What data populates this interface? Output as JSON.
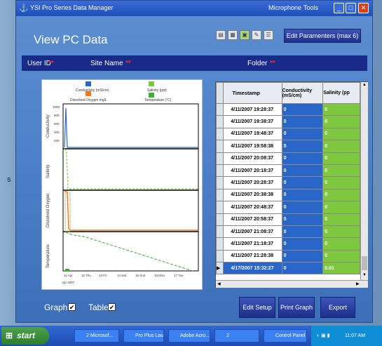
{
  "window": {
    "title": "YSI Pro Series Data Manager",
    "menu": [
      "Microphone",
      "Tools"
    ],
    "page_title": "View PC Data",
    "edit_params_label": "Edit Paramenters (max 6)"
  },
  "fields": [
    {
      "label": "User ID",
      "required": "**"
    },
    {
      "label": "Site Name",
      "required": "**"
    },
    {
      "label": "Folder",
      "required": "**"
    }
  ],
  "graph": {
    "legend": [
      "Conductivity (mS/cm)",
      "Salinity (ppt)",
      "Dissolved Oxygen mg/L",
      "Temperature (°C)"
    ],
    "axes": [
      "Conductivity",
      "Salinity",
      "Dissolved Oxygen",
      "Temperature"
    ],
    "y_ticks": {
      "conductivity": [
        "1000",
        "800",
        "600",
        "400",
        "200"
      ]
    },
    "x_ticks": [
      "11 Apr",
      "12 Thu",
      "13 Fri",
      "14 Sat",
      "15 Sun",
      "16 Mon",
      "17 Tue"
    ],
    "x_sub": "Apr 2007"
  },
  "table": {
    "columns": [
      "Timestamp",
      "Conductivity (mS/cm)",
      "Salinity (pp"
    ],
    "rows": [
      {
        "ts": "4/11/2007 19:28:37",
        "cond": "0",
        "sal": "0"
      },
      {
        "ts": "4/11/2007 19:38:37",
        "cond": "0",
        "sal": "0"
      },
      {
        "ts": "4/11/2007 19:48:37",
        "cond": "0",
        "sal": "0"
      },
      {
        "ts": "4/11/2007 19:58:38",
        "cond": "0",
        "sal": "0"
      },
      {
        "ts": "4/11/2007 20:08:37",
        "cond": "0",
        "sal": "0"
      },
      {
        "ts": "4/11/2007 20:18:37",
        "cond": "0",
        "sal": "0"
      },
      {
        "ts": "4/11/2007 20:28:37",
        "cond": "0",
        "sal": "0"
      },
      {
        "ts": "4/11/2007 20:38:38",
        "cond": "0",
        "sal": "0"
      },
      {
        "ts": "4/11/2007 20:48:37",
        "cond": "0",
        "sal": "0"
      },
      {
        "ts": "4/11/2007 20:58:37",
        "cond": "0",
        "sal": "0"
      },
      {
        "ts": "4/11/2007 21:08:37",
        "cond": "0",
        "sal": "0"
      },
      {
        "ts": "4/11/2007 21:18:37",
        "cond": "0",
        "sal": "0"
      },
      {
        "ts": "4/11/2007 21:28:38",
        "cond": "0",
        "sal": "0"
      },
      {
        "ts": "4/17/2007 15:32:27",
        "cond": "0",
        "sal": "0.01"
      }
    ]
  },
  "controls": {
    "graph_label": "Graph",
    "table_label": "Table",
    "check_mark": "✔",
    "edit_setup": "Edit Setup",
    "print_graph": "Print Graph",
    "export": "Export"
  },
  "taskbar": {
    "start": "start",
    "tasks": [
      "2 Microsof...",
      "Pro Plus Lau...",
      "Adobe Acro...",
      "2",
      "Control Panel"
    ],
    "clock": "11:07 AM"
  },
  "desktop_fragment": "s",
  "colors": {
    "conductivity": "#2a66c8",
    "salinity": "#7ec840",
    "dissolved_oxygen": "#f07820",
    "temperature": "#39b039",
    "header_bar": "#1a2a88"
  }
}
